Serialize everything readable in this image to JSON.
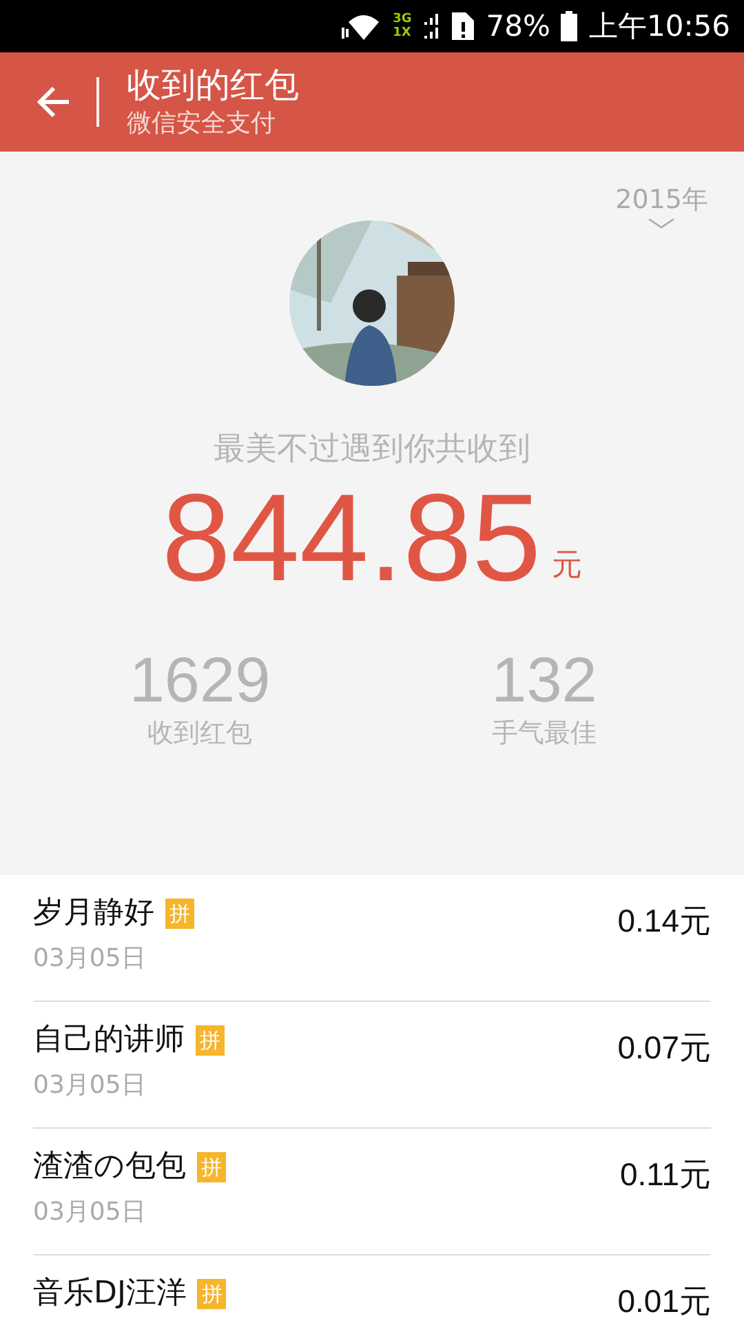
{
  "status_bar": {
    "network_top": "3G",
    "network_bottom": "1X",
    "battery": "78%",
    "time": "上午10:56"
  },
  "header": {
    "title": "收到的红包",
    "subtitle": "微信安全支付"
  },
  "summary": {
    "year": "2015年",
    "caption": "最美不过遇到你共收到",
    "amount": "844.85",
    "unit": "元",
    "stats": [
      {
        "value": "1629",
        "label": "收到红包"
      },
      {
        "value": "132",
        "label": "手气最佳"
      }
    ]
  },
  "records": [
    {
      "name": "岁月静好",
      "tag": "拼",
      "date": "03月05日",
      "amount": "0.14元"
    },
    {
      "name": "自己的讲师",
      "tag": "拼",
      "date": "03月05日",
      "amount": "0.07元"
    },
    {
      "name": "渣渣の包包",
      "tag": "拼",
      "date": "03月05日",
      "amount": "0.11元"
    },
    {
      "name": "音乐DJ汪洋",
      "tag": "拼",
      "amount": "0.01元"
    }
  ]
}
